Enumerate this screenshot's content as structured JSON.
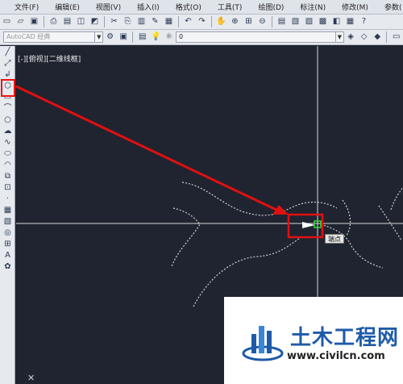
{
  "menubar": {
    "items": [
      "文件(F)",
      "编辑(E)",
      "视图(V)",
      "插入(I)",
      "格式(O)",
      "工具(T)",
      "绘图(D)",
      "标注(N)",
      "修改(M)",
      "参数("
    ]
  },
  "toolbar": {
    "workspace": "AutoCAD 经典",
    "layer_value": "0"
  },
  "canvas": {
    "viewport_label": "[-][俯视][二维线框]",
    "tooltip": "端点",
    "background": "#1f2430",
    "annotation_color": "#e01010"
  },
  "watermark": {
    "title": "土木工程网",
    "url": "www.civilcn.com"
  }
}
